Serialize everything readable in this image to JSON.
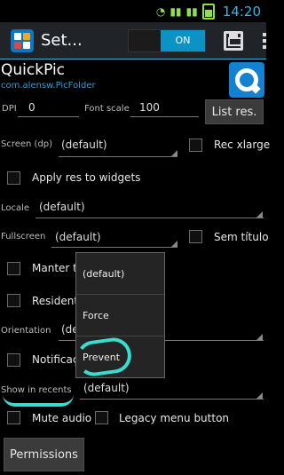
{
  "status_bar": {
    "battery_level": "60",
    "time": "14:20"
  },
  "action_bar": {
    "title": "Set...",
    "toggle_state": "ON"
  },
  "app": {
    "name": "QuickPic",
    "package": "com.alensw.PicFolder"
  },
  "settings": {
    "dpi_label": "DPI",
    "dpi_value": "0",
    "font_scale_label": "Font scale",
    "font_scale_value": "100",
    "list_res_button": "List res.",
    "screen_dp_label": "Screen (dp)",
    "screen_dp_value": "(default)",
    "rec_xlarge_label": "Rec xlarge",
    "apply_res_label": "Apply res to widgets",
    "locale_label": "Locale",
    "locale_value": "(default)",
    "fullscreen_label": "Fullscreen",
    "fullscreen_value": "(default)",
    "sem_titulo_label": "Sem título",
    "manter_label": "Manter t",
    "resident_label": "Resident",
    "orientation_label": "Orientation",
    "orientation_value_partial": "(de",
    "notification_label": "Notificaç",
    "show_in_recents_label": "Show in recents",
    "show_in_recents_value": "(default)",
    "mute_audio_label": "Mute audio",
    "legacy_menu_label": "Legacy menu button",
    "permissions_button": "Permissions"
  },
  "popup": {
    "options": [
      "(default)",
      "Force",
      "Prevent"
    ]
  },
  "colors": {
    "accent": "#33b5e5",
    "annotation": "#39ddd0"
  }
}
